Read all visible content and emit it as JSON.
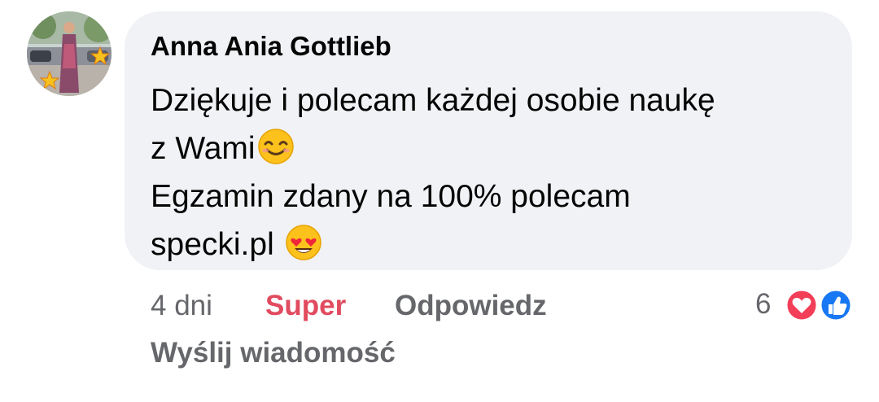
{
  "comment": {
    "author": "Anna Ania Gottlieb",
    "lines": [
      "Dziękuje i polecam każdej osobie naukę",
      "z Wami",
      "Egzamin zdany na 100% polecam",
      "specki.pl"
    ],
    "emoji_line2": "smiling-face-emoji",
    "emoji_line4": "heart-eyes-emoji"
  },
  "actions": {
    "time": "4 dni",
    "reaction_label": "Super",
    "reply_label": "Odpowiedz",
    "send_message_label": "Wyślij wiadomość"
  },
  "reactions": {
    "count": "6",
    "icons": [
      "heart-icon",
      "like-icon"
    ]
  },
  "colors": {
    "bubble": "#f0f2f5",
    "text": "#050505",
    "meta": "#65676b",
    "super": "#e14b5f",
    "heart": "#f33e58",
    "like": "#1877f2"
  }
}
